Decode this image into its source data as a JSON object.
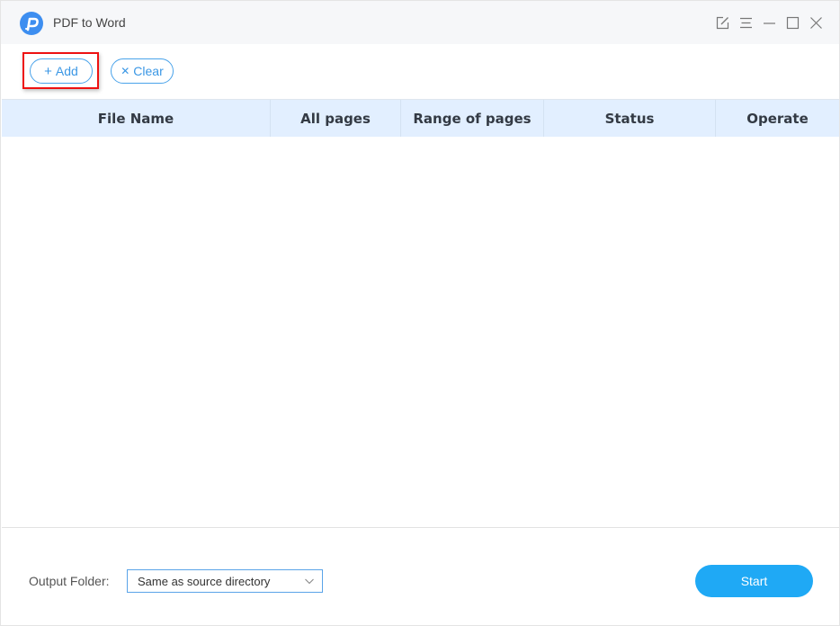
{
  "app": {
    "title": "PDF to Word",
    "logo_icon": "pdf-converter-logo",
    "brand_color": "#3d8ef0"
  },
  "window_controls": [
    {
      "name": "feedback",
      "icon": "edit-icon"
    },
    {
      "name": "menu",
      "icon": "menu-icon"
    },
    {
      "name": "minimize",
      "icon": "minimize-icon"
    },
    {
      "name": "maximize",
      "icon": "maximize-icon"
    },
    {
      "name": "close",
      "icon": "close-icon"
    }
  ],
  "toolbar": {
    "add_label": "Add",
    "add_icon": "+",
    "clear_label": "Clear",
    "clear_icon": "✕",
    "accent_color": "#3b97e5",
    "highlighted": "add"
  },
  "table": {
    "columns": [
      "File Name",
      "All pages",
      "Range of pages",
      "Status",
      "Operate"
    ],
    "rows": []
  },
  "footer": {
    "output_label": "Output Folder:",
    "output_value": "Same as source directory",
    "start_label": "Start",
    "start_color": "#1fa9f5"
  }
}
